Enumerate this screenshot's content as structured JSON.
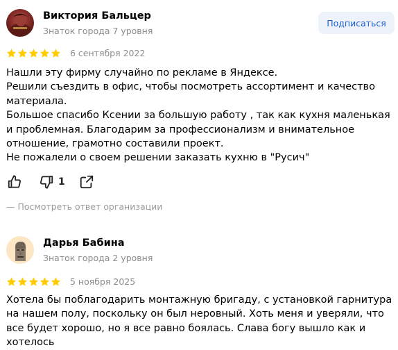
{
  "reviews": [
    {
      "author": "Виктория Бальцер",
      "level": "Знаток города 7 уровня",
      "subscribe_label": "Подписаться",
      "rating": 5,
      "date": "6 сентября 2022",
      "text_lines": [
        "Нашли эту фирму случайно по рекламе в Яндексе.",
        "Решили съездить в офис, чтобы посмотреть ассортимент и качество материала.",
        "Большое спасибо Ксении за большую работу , так как кухня маленькая и проблемная. Благодарим за профессионализм и внимательное отношение, грамотно составили проект.",
        "Не пожалели о своем решении заказать кухню в \"Русич\""
      ],
      "dislike_count": "1",
      "org_reply_label": "— Посмотреть ответ организации",
      "avatar_icon": "user-photo-avatar"
    },
    {
      "author": "Дарья Бабина",
      "level": "Знаток города 2 уровня",
      "rating": 5,
      "date": "5 ноября 2025",
      "text_lines": [
        "Хотела бы поблагодарить монтажную бригаду, с установкой гарнитура на нашем полу, поскольку он был неровный. Хоть меня и уверяли, что все будет хорошо, но я все равно боялась. Слава богу вышло как и хотелось"
      ],
      "avatar_icon": "moai-statue-avatar"
    }
  ],
  "colors": {
    "star": "#fc0",
    "link_blue": "#1d5fd1",
    "muted_text": "#8c8c8c",
    "subscribe_bg": "#eef3fb"
  }
}
